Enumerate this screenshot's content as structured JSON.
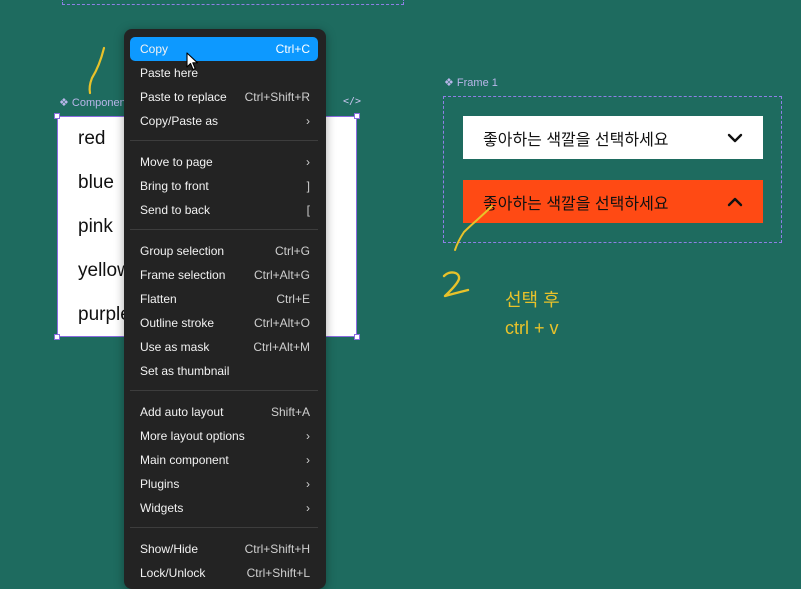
{
  "component": {
    "label": "Componen",
    "code_icon": "</>",
    "items": [
      "red",
      "blue",
      "pink",
      "yellow",
      "purple"
    ]
  },
  "context_menu": {
    "groups": [
      [
        {
          "label": "Copy",
          "shortcut": "Ctrl+C",
          "active": true
        },
        {
          "label": "Paste here",
          "shortcut": ""
        },
        {
          "label": "Paste to replace",
          "shortcut": "Ctrl+Shift+R"
        },
        {
          "label": "Copy/Paste as",
          "shortcut": "›"
        }
      ],
      [
        {
          "label": "Move to page",
          "shortcut": "›"
        },
        {
          "label": "Bring to front",
          "shortcut": "]"
        },
        {
          "label": "Send to back",
          "shortcut": "["
        }
      ],
      [
        {
          "label": "Group selection",
          "shortcut": "Ctrl+G"
        },
        {
          "label": "Frame selection",
          "shortcut": "Ctrl+Alt+G"
        },
        {
          "label": "Flatten",
          "shortcut": "Ctrl+E"
        },
        {
          "label": "Outline stroke",
          "shortcut": "Ctrl+Alt+O"
        },
        {
          "label": "Use as mask",
          "shortcut": "Ctrl+Alt+M"
        },
        {
          "label": "Set as thumbnail",
          "shortcut": ""
        }
      ],
      [
        {
          "label": "Add auto layout",
          "shortcut": "Shift+A"
        },
        {
          "label": "More layout options",
          "shortcut": "›"
        },
        {
          "label": "Main component",
          "shortcut": "›"
        },
        {
          "label": "Plugins",
          "shortcut": "›"
        },
        {
          "label": "Widgets",
          "shortcut": "›"
        }
      ],
      [
        {
          "label": "Show/Hide",
          "shortcut": "Ctrl+Shift+H"
        },
        {
          "label": "Lock/Unlock",
          "shortcut": "Ctrl+Shift+L"
        }
      ]
    ]
  },
  "frame1": {
    "label": "Frame 1",
    "dropdown_closed_text": "좋아하는 색깔을 선택하세요",
    "dropdown_open_text": "좋아하는 색깔을 선택하세요",
    "open_color": "#ff4a14"
  },
  "annotation": {
    "number": "2",
    "line1": "선택 후",
    "line2": "ctrl + v",
    "color": "#e8c22a"
  },
  "colors": {
    "canvas": "#1e6b5f",
    "selection": "#8a6be0",
    "menu_bg": "#232323",
    "menu_active": "#0d99ff"
  }
}
